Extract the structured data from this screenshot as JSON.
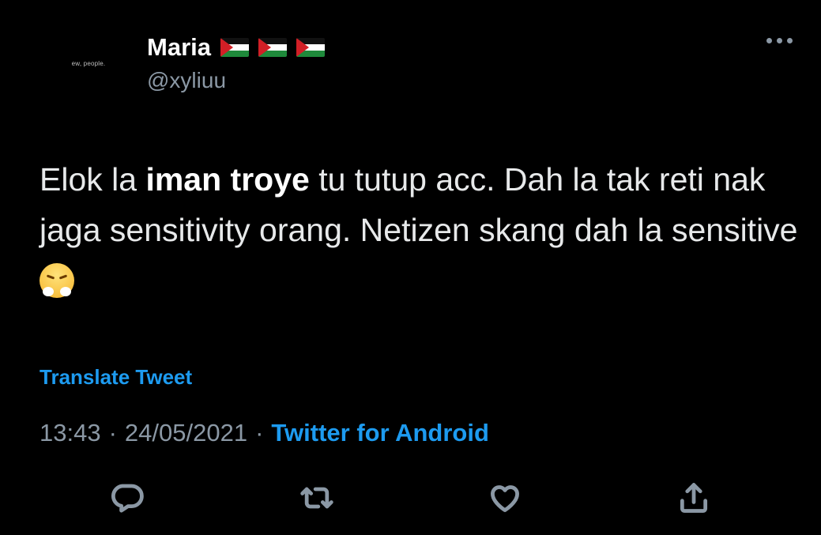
{
  "user": {
    "avatar_text": "ew, people.",
    "display_name": "Maria",
    "flag_icons": [
      "palestine-flag",
      "palestine-flag",
      "palestine-flag"
    ],
    "handle": "@xyliuu"
  },
  "tweet": {
    "text_before": "Elok la ",
    "mention_bold": "iman troye",
    "text_after": " tu tutup acc. Dah la tak reti nak jaga sensitivity orang. Netizen skang dah la sensitive ",
    "emoji": "face-with-steam-from-nose"
  },
  "translate_label": "Translate Tweet",
  "meta": {
    "time": "13:43",
    "separator": "·",
    "date": "24/05/2021",
    "source": "Twitter for Android"
  },
  "actions": [
    "reply-icon",
    "retweet-icon",
    "like-icon",
    "share-icon"
  ],
  "colors": {
    "background": "#000000",
    "link": "#1d9bf0",
    "muted": "#8b98a5",
    "text": "#e7e9ea"
  }
}
